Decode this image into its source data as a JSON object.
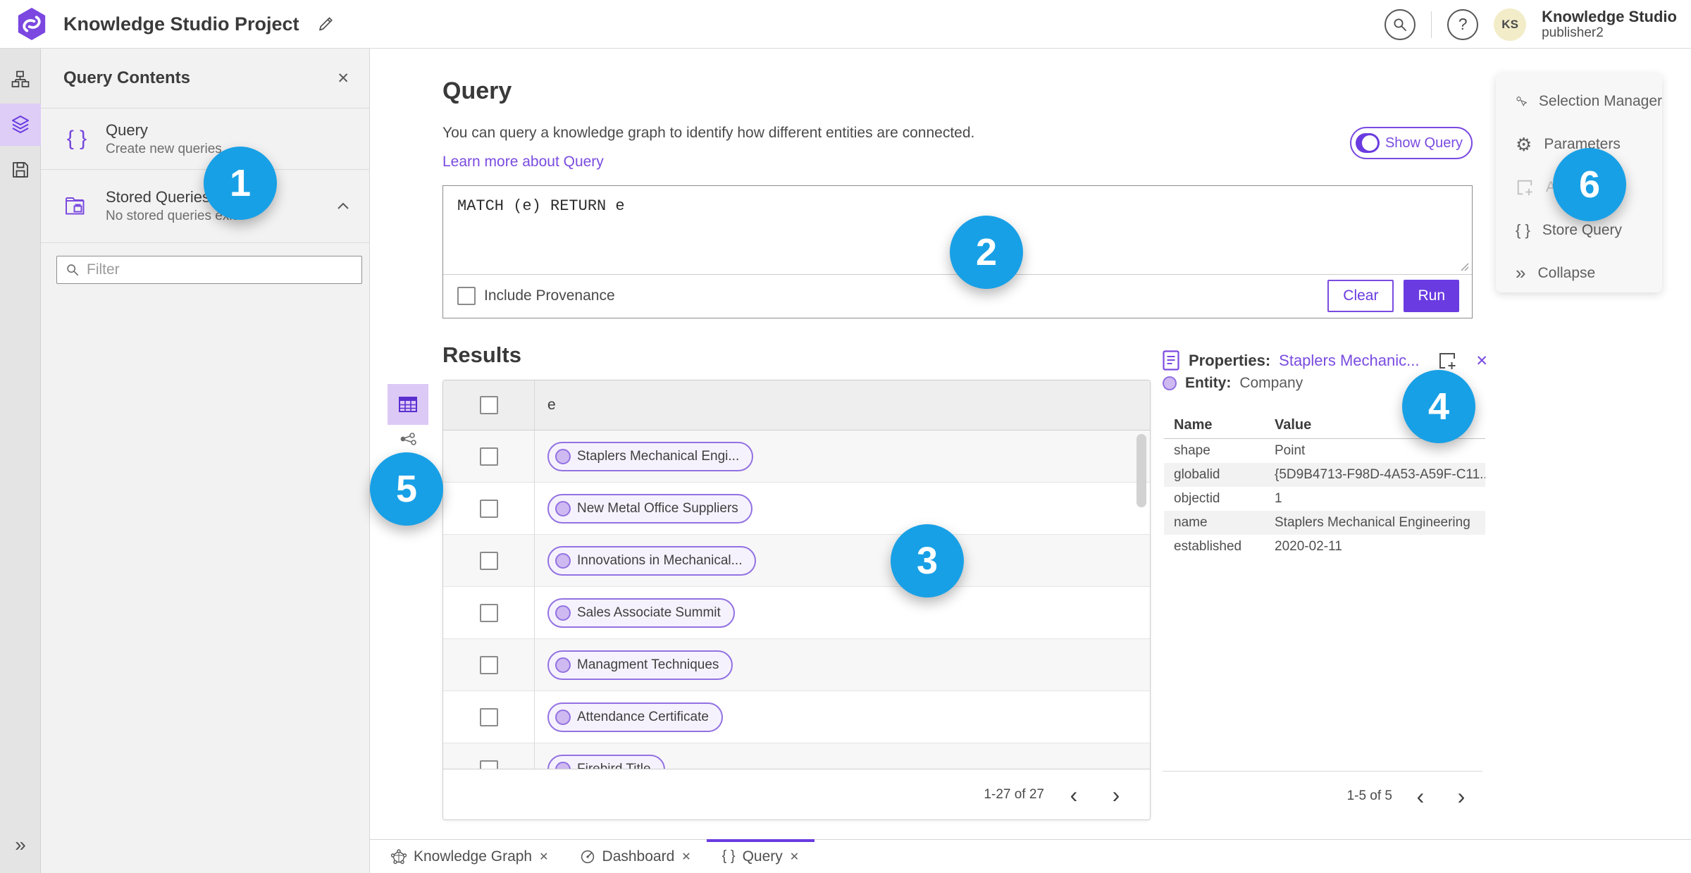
{
  "colors": {
    "accent_purple": "#6a3be0",
    "link_purple": "#7a4be0",
    "annotation_blue": "#18a0e6",
    "pill_border": "#9272e2",
    "pill_fill": "#f6f2fd",
    "active_item_bg": "#ddcdf7"
  },
  "icons": {
    "close": "✕",
    "braces": "{ }",
    "collapse": "»",
    "expand": "»",
    "gear": "⚙",
    "question": "?",
    "chevron_left": "‹",
    "chevron_right": "›"
  },
  "topbar": {
    "title": "Knowledge Studio Project",
    "avatar_initials": "KS",
    "user_name": "Knowledge Studio",
    "user_role": "publisher2"
  },
  "query_contents": {
    "title": "Query Contents",
    "items": [
      {
        "title": "Query",
        "subtitle": "Create new queries"
      },
      {
        "title": "Stored Queries",
        "subtitle": "No stored queries exist"
      }
    ],
    "filter_placeholder": "Filter"
  },
  "query_panel": {
    "title": "Query",
    "description": "You can query a knowledge graph to identify how different entities are connected.",
    "learn_more": "Learn more about Query",
    "show_query_label": "Show Query",
    "show_query_on": true,
    "query_text": "MATCH (e) RETURN e",
    "include_provenance_label": "Include Provenance",
    "clear_label": "Clear",
    "run_label": "Run"
  },
  "results": {
    "title": "Results",
    "column_header": "e",
    "rows": [
      "Staplers Mechanical Engi...",
      "New Metal Office Suppliers",
      "Innovations in Mechanical...",
      "Sales Associate Summit",
      "Managment Techniques",
      "Attendance Certificate",
      "Firebird Title"
    ],
    "pagination": "1-27 of 27"
  },
  "properties": {
    "label": "Properties:",
    "selected_entity": "Staplers Mechanic...",
    "entity_label": "Entity:",
    "entity_type": "Company",
    "columns": {
      "name": "Name",
      "value": "Value"
    },
    "rows": [
      {
        "name": "shape",
        "value": "Point"
      },
      {
        "name": "globalid",
        "value": "{5D9B4713-F98D-4A53-A59F-C11..."
      },
      {
        "name": "objectid",
        "value": "1"
      },
      {
        "name": "name",
        "value": "Staplers Mechanical Engineering"
      },
      {
        "name": "established",
        "value": "2020-02-11"
      }
    ],
    "pagination": "1-5 of 5"
  },
  "actions": {
    "items": [
      "Selection Manager",
      "Parameters",
      "Add",
      "Store Query",
      "Collapse"
    ]
  },
  "tabs": [
    {
      "label": "Knowledge Graph"
    },
    {
      "label": "Dashboard"
    },
    {
      "label": "Query"
    }
  ],
  "annotations": [
    "1",
    "2",
    "3",
    "4",
    "5",
    "6"
  ]
}
